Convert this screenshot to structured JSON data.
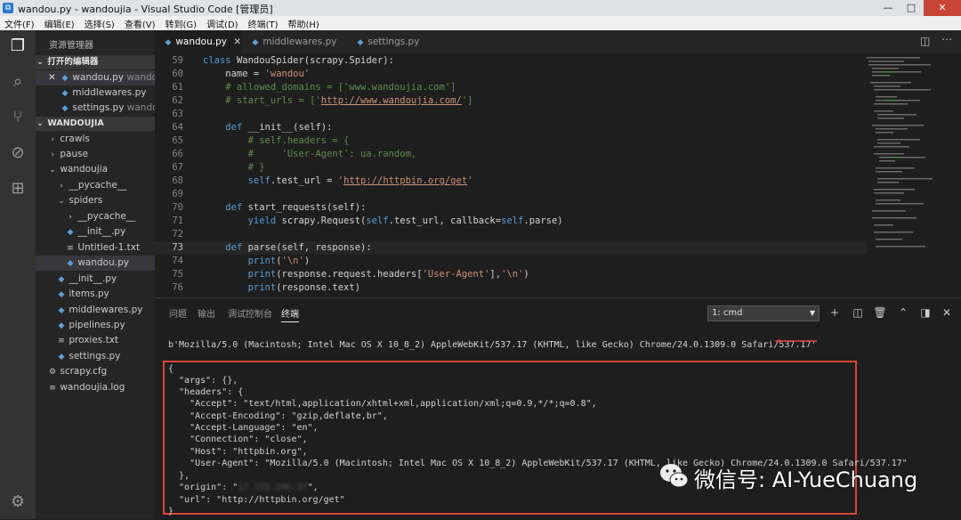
{
  "window": {
    "title": "wandou.py - wandoujia - Visual Studio Code [管理员]",
    "controls": [
      "—",
      "□",
      "✕"
    ]
  },
  "menu": [
    "文件(F)",
    "编辑(E)",
    "选择(S)",
    "查看(V)",
    "转到(G)",
    "调试(D)",
    "终端(T)",
    "帮助(H)"
  ],
  "sidebar": {
    "header": "资源管理器",
    "open_editors_title": "打开的编辑器",
    "open_editors": [
      {
        "name": "wandou.py",
        "hint": "wando...",
        "close": "✕"
      },
      {
        "name": "middlewares.py",
        "hint": ""
      },
      {
        "name": "settings.py",
        "hint": "wando..."
      }
    ],
    "project_title": "WANDOUJIA",
    "tree": [
      {
        "label": "crawls",
        "kind": "folder",
        "arrow": "›"
      },
      {
        "label": "pause",
        "kind": "folder",
        "arrow": "›"
      },
      {
        "label": "wandoujia",
        "kind": "folder",
        "arrow": "⌄"
      },
      {
        "label": "__pycache__",
        "kind": "folder",
        "arrow": "›"
      },
      {
        "label": "spiders",
        "kind": "folder",
        "arrow": "⌄"
      },
      {
        "label": "__pycache__",
        "kind": "folder",
        "arrow": "›"
      },
      {
        "label": "__init__.py",
        "kind": "py"
      },
      {
        "label": "Untitled-1.txt",
        "kind": "txt"
      },
      {
        "label": "wandou.py",
        "kind": "py"
      },
      {
        "label": "__init__.py",
        "kind": "py"
      },
      {
        "label": "items.py",
        "kind": "py"
      },
      {
        "label": "middlewares.py",
        "kind": "py"
      },
      {
        "label": "pipelines.py",
        "kind": "py"
      },
      {
        "label": "proxies.txt",
        "kind": "txt"
      },
      {
        "label": "settings.py",
        "kind": "py"
      },
      {
        "label": "scrapy.cfg",
        "kind": "cfg"
      },
      {
        "label": "wandoujia.log",
        "kind": "txt"
      }
    ]
  },
  "tabs": [
    {
      "label": "wandou.py",
      "close": "✕"
    },
    {
      "label": "middlewares.py"
    },
    {
      "label": "settings.py"
    }
  ],
  "editor": {
    "line_numbers": [
      "59",
      "60",
      "61",
      "62",
      "63",
      "64",
      "65",
      "66",
      "67",
      "68",
      "69",
      "70",
      "71",
      "72",
      "73",
      "74",
      "75",
      "76"
    ],
    "current_line": "73"
  },
  "panel": {
    "tabs": [
      "问题",
      "输出",
      "调试控制台",
      "终端"
    ],
    "terminal_select": "1: cmd",
    "user_agent_line": "b'Mozilla/5.0 (Macintosh; Intel Mac OS X 10_8_2) AppleWebKit/537.17 (KHTML, like Gecko) Chrome/24.0.1309.0 Safari/537.17'",
    "json_lines": [
      "{",
      "  \"args\": {},",
      "  \"headers\": {",
      "    \"Accept\": \"text/html,application/xhtml+xml,application/xml;q=0.9,*/*;q=0.8\",",
      "    \"Accept-Encoding\": \"gzip,deflate,br\",",
      "    \"Accept-Language\": \"en\",",
      "    \"Connection\": \"close\",",
      "    \"Host\": \"httpbin.org\",",
      "    \"User-Agent\": \"Mozilla/5.0 (Macintosh; Intel Mac OS X 10_8_2) AppleWebKit/537.17 (KHTML, like Gecko) Chrome/24.0.1309.0 Safari/537.17\"",
      "  },",
      "  \"origin\": \"",
      "  \"url\": \"http://httpbin.org/get\"",
      "}"
    ],
    "origin_blurred": "17.155.206.37",
    "origin_suffix": "\","
  },
  "watermark": "微信号: AI-YueChuang",
  "colors": {
    "accent_red": "#d9453a",
    "activity": "#333333",
    "sidebar": "#252526",
    "editor": "#1e1e1e"
  }
}
